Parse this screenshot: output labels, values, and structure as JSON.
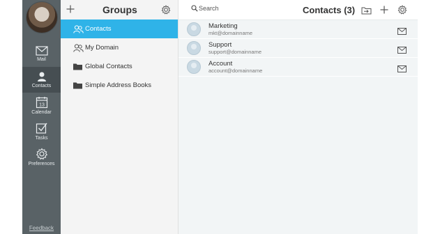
{
  "nav": {
    "items": [
      {
        "label": "Mail",
        "icon": "mail-icon"
      },
      {
        "label": "Contacts",
        "icon": "contacts-icon",
        "active": true
      },
      {
        "label": "Calendar",
        "icon": "calendar-icon",
        "day": "13"
      },
      {
        "label": "Tasks",
        "icon": "tasks-icon"
      },
      {
        "label": "Preferences",
        "icon": "gear-icon"
      }
    ],
    "feedback": "Feedback"
  },
  "groups": {
    "title": "Groups",
    "add_icon": "plus-icon",
    "settings_icon": "gear-icon",
    "items": [
      {
        "label": "Contacts",
        "icon": "contacts-icon",
        "active": true
      },
      {
        "label": "My Domain",
        "icon": "contacts-icon"
      },
      {
        "label": "Global Contacts",
        "icon": "folder-icon"
      },
      {
        "label": "Simple Address Books",
        "icon": "folder-icon"
      }
    ]
  },
  "contacts": {
    "search_placeholder": "Search",
    "title": "Contacts (3)",
    "list": [
      {
        "name": "Marketing",
        "email": "mkt@domainname"
      },
      {
        "name": "Support",
        "email": "support@domainname"
      },
      {
        "name": "Account",
        "email": "account@domainname"
      }
    ]
  },
  "colors": {
    "rail": "#596266",
    "rail_active": "#464e52",
    "accent": "#2fb3e8",
    "groups_bg": "#f4f4f4",
    "contacts_bg": "#f2f5f6"
  }
}
